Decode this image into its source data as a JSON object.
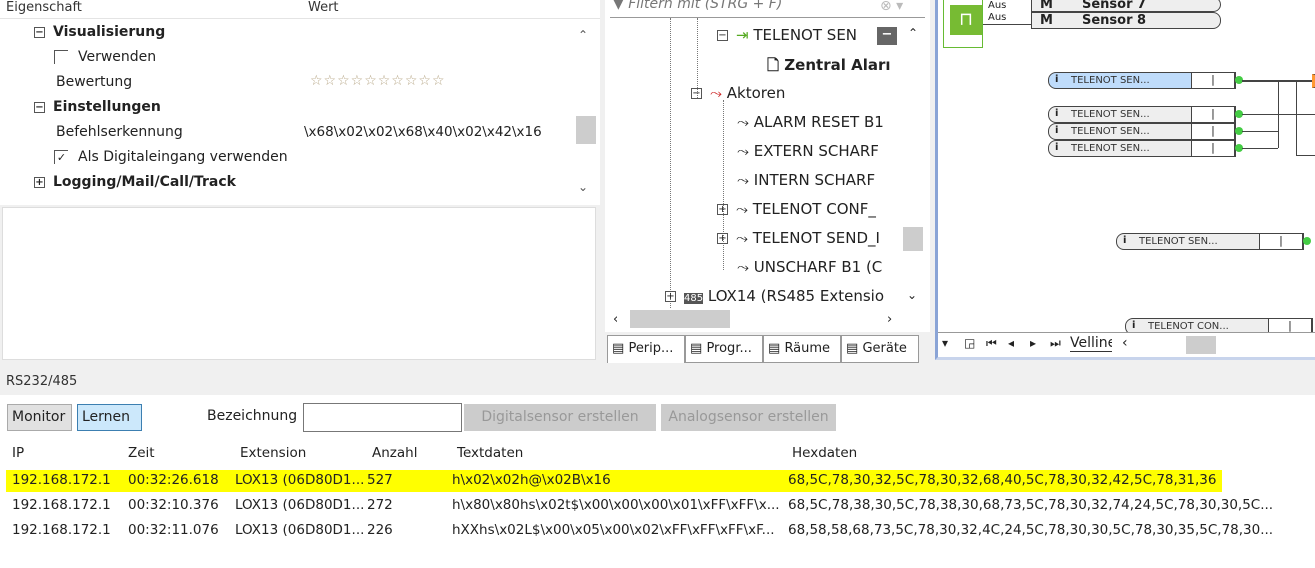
{
  "properties": {
    "col_property": "Eigenschaft",
    "col_value": "Wert",
    "rows": [
      {
        "label": "Visualisierung",
        "type": "group",
        "expanded": true
      },
      {
        "label": "Verwenden",
        "type": "checkbox",
        "checked": false
      },
      {
        "label": "Bewertung",
        "value": "☆☆☆☆☆☆☆☆☆☆",
        "stars": 0
      },
      {
        "label": "Einstellungen",
        "type": "group",
        "expanded": true
      },
      {
        "label": "Befehlserkennung",
        "value": "\\x68\\x02\\x02\\x68\\x40\\x02\\x42\\x16"
      },
      {
        "label": "Als Digitaleingang verwenden",
        "type": "checkbox",
        "checked": true
      },
      {
        "label": "Logging/Mail/Call/Track",
        "type": "group",
        "expanded": false
      }
    ]
  },
  "tree": {
    "filter_placeholder": "Filtern mit (STRG + F)",
    "items": [
      "TELENOT SEN",
      "Zentral Aları",
      "Aktoren",
      "ALARM RESET B1",
      "EXTERN SCHARF",
      "INTERN SCHARF",
      "TELENOT CONF_",
      "TELENOT SEND_I",
      "UNSCHARF B1 (C",
      "LOX14 (RS485 Extensio"
    ],
    "tabs": [
      "Perip...",
      "Progr...",
      "Räume",
      "Geräte"
    ]
  },
  "diagram": {
    "aus1": "Aus",
    "aus2": "Aus",
    "m": "M",
    "sensor7": "Sensor 7",
    "sensor8": "Sensor 8",
    "blocks": [
      "TELENOT SEN...",
      "TELENOT SEN...",
      "TELENOT SEN...",
      "TELENOT SEN...",
      "TELENOT SEN...",
      "TELENOT CON..."
    ],
    "page_tab": "Velline"
  },
  "bottom": {
    "title": "RS232/485",
    "monitor": "Monitor",
    "learn": "Lernen",
    "name_label": "Bezeichnung",
    "name_value": "",
    "digital_btn": "Digitalsensor erstellen",
    "analog_btn": "Analogsensor erstellen",
    "columns": [
      "IP",
      "Zeit",
      "Extension",
      "Anzahl",
      "Textdaten",
      "Hexdaten"
    ],
    "rows": [
      [
        "192.168.172.1",
        "00:32:26.618",
        "LOX13 (06D80D1...",
        "527",
        "h\\x02\\x02h@\\x02B\\x16",
        "68,5C,78,30,32,5C,78,30,32,68,40,5C,78,30,32,42,5C,78,31,36"
      ],
      [
        "192.168.172.1",
        "00:32:10.376",
        "LOX13 (06D80D1...",
        "272",
        "h\\x80\\x80hs\\x02t$\\x00\\x00\\x00\\x01\\xFF\\xFF\\x...",
        "68,5C,78,38,30,5C,78,38,30,68,73,5C,78,30,32,74,24,5C,78,30,30,5C..."
      ],
      [
        "192.168.172.1",
        "00:32:11.076",
        "LOX13 (06D80D1...",
        "226",
        "hXXhs\\x02L$\\x00\\x05\\x00\\x02\\xFF\\xFF\\xFF\\xF...",
        "68,58,58,68,73,5C,78,30,32,4C,24,5C,78,30,30,5C,78,30,35,5C,78,30..."
      ]
    ],
    "highlight_color": "#ffff00"
  }
}
